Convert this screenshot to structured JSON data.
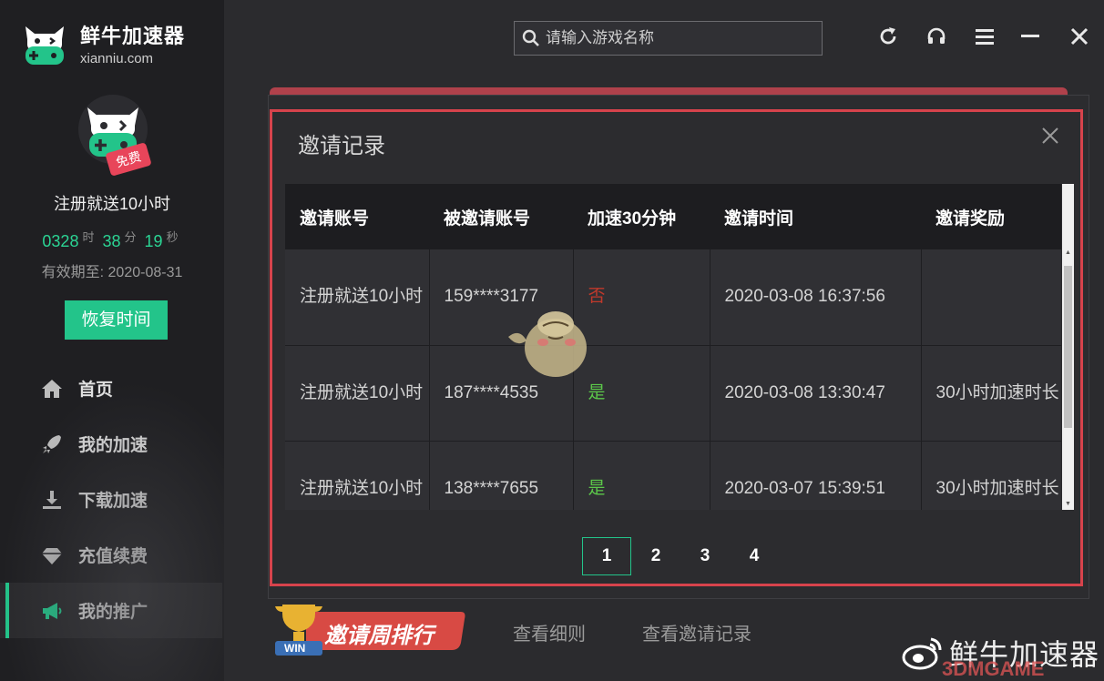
{
  "app": {
    "title": "鲜牛加速器",
    "domain": "xianniu.com"
  },
  "profile": {
    "badge": "免费",
    "plan_name": "注册就送10小时",
    "countdown": {
      "hours": "0328",
      "hours_unit": "时",
      "minutes": "38",
      "minutes_unit": "分",
      "seconds": "19",
      "seconds_unit": "秒"
    },
    "expiry": "有效期至: 2020-08-31",
    "restore_button": "恢复时间"
  },
  "nav": [
    {
      "label": "首页",
      "icon": "home-icon"
    },
    {
      "label": "我的加速",
      "icon": "rocket-icon"
    },
    {
      "label": "下载加速",
      "icon": "download-icon"
    },
    {
      "label": "充值续费",
      "icon": "diamond-icon"
    },
    {
      "label": "我的推广",
      "icon": "megaphone-icon",
      "active": true
    }
  ],
  "search": {
    "placeholder": "请输入游戏名称"
  },
  "modal": {
    "title": "邀请记录",
    "columns": [
      "邀请账号",
      "被邀请账号",
      "加速30分钟",
      "邀请时间",
      "邀请奖励"
    ],
    "rows": [
      {
        "inviter": "注册就送10小时",
        "invitee": "159****3177",
        "speedup": "否",
        "time": "2020-03-08 16:37:56",
        "reward": ""
      },
      {
        "inviter": "注册就送10小时",
        "invitee": "187****4535",
        "speedup": "是",
        "time": "2020-03-08 13:30:47",
        "reward": "30小时加速时长"
      },
      {
        "inviter": "注册就送10小时",
        "invitee": "138****7655",
        "speedup": "是",
        "time": "2020-03-07 15:39:51",
        "reward": "30小时加速时长"
      }
    ],
    "pages": [
      "1",
      "2",
      "3",
      "4"
    ],
    "current_page": "1"
  },
  "bottom": {
    "rank_badge": "邀请周排行",
    "rank_badge_sub": "WIN",
    "link_rules": "查看细则",
    "link_records": "查看邀请记录"
  },
  "watermark": {
    "text": "鲜牛加速器",
    "site": "3DMGAME"
  },
  "colors": {
    "accent": "#23c48a",
    "modal_border": "#d7434c",
    "no": "#c0392b",
    "yes": "#5cc84a"
  }
}
